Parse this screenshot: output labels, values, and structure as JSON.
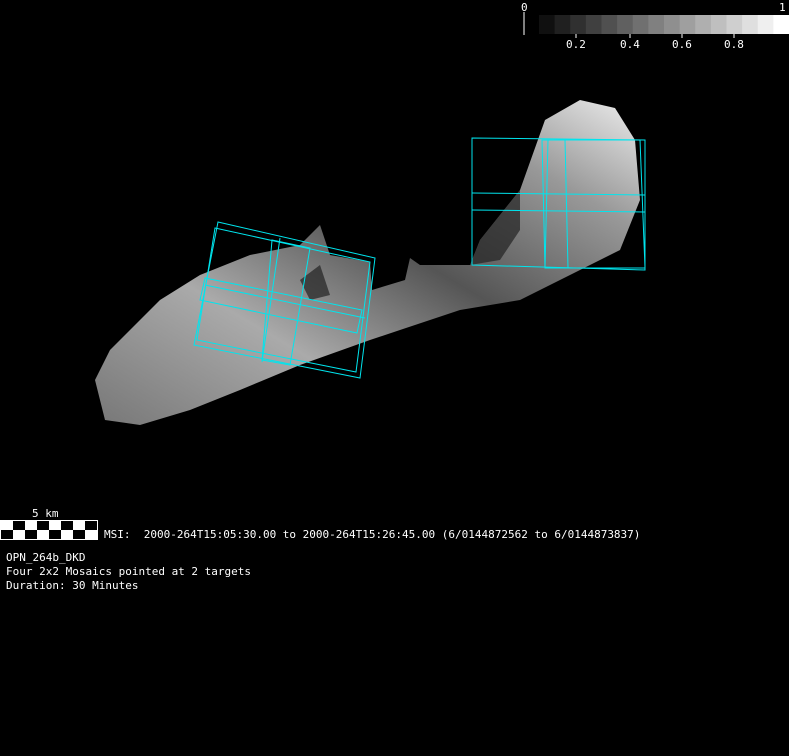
{
  "colorbar": {
    "min_label": "0",
    "max_label": "1",
    "ticks": [
      "0.2",
      "0.4",
      "0.6",
      "0.8"
    ],
    "steps": 16
  },
  "scale_bar": {
    "label": "5 km"
  },
  "caption": {
    "msi_line": "MSI:  2000-264T15:05:30.00 to 2000-264T15:26:45.00 (6/0144872562 to 6/0144873837)",
    "sequence": "OPN_264b_DKD",
    "description": "Four 2x2 Mosaics pointed at 2 targets",
    "duration": "Duration: 30 Minutes"
  },
  "colors": {
    "footprint": "#00e5ee",
    "background": "#000000"
  }
}
